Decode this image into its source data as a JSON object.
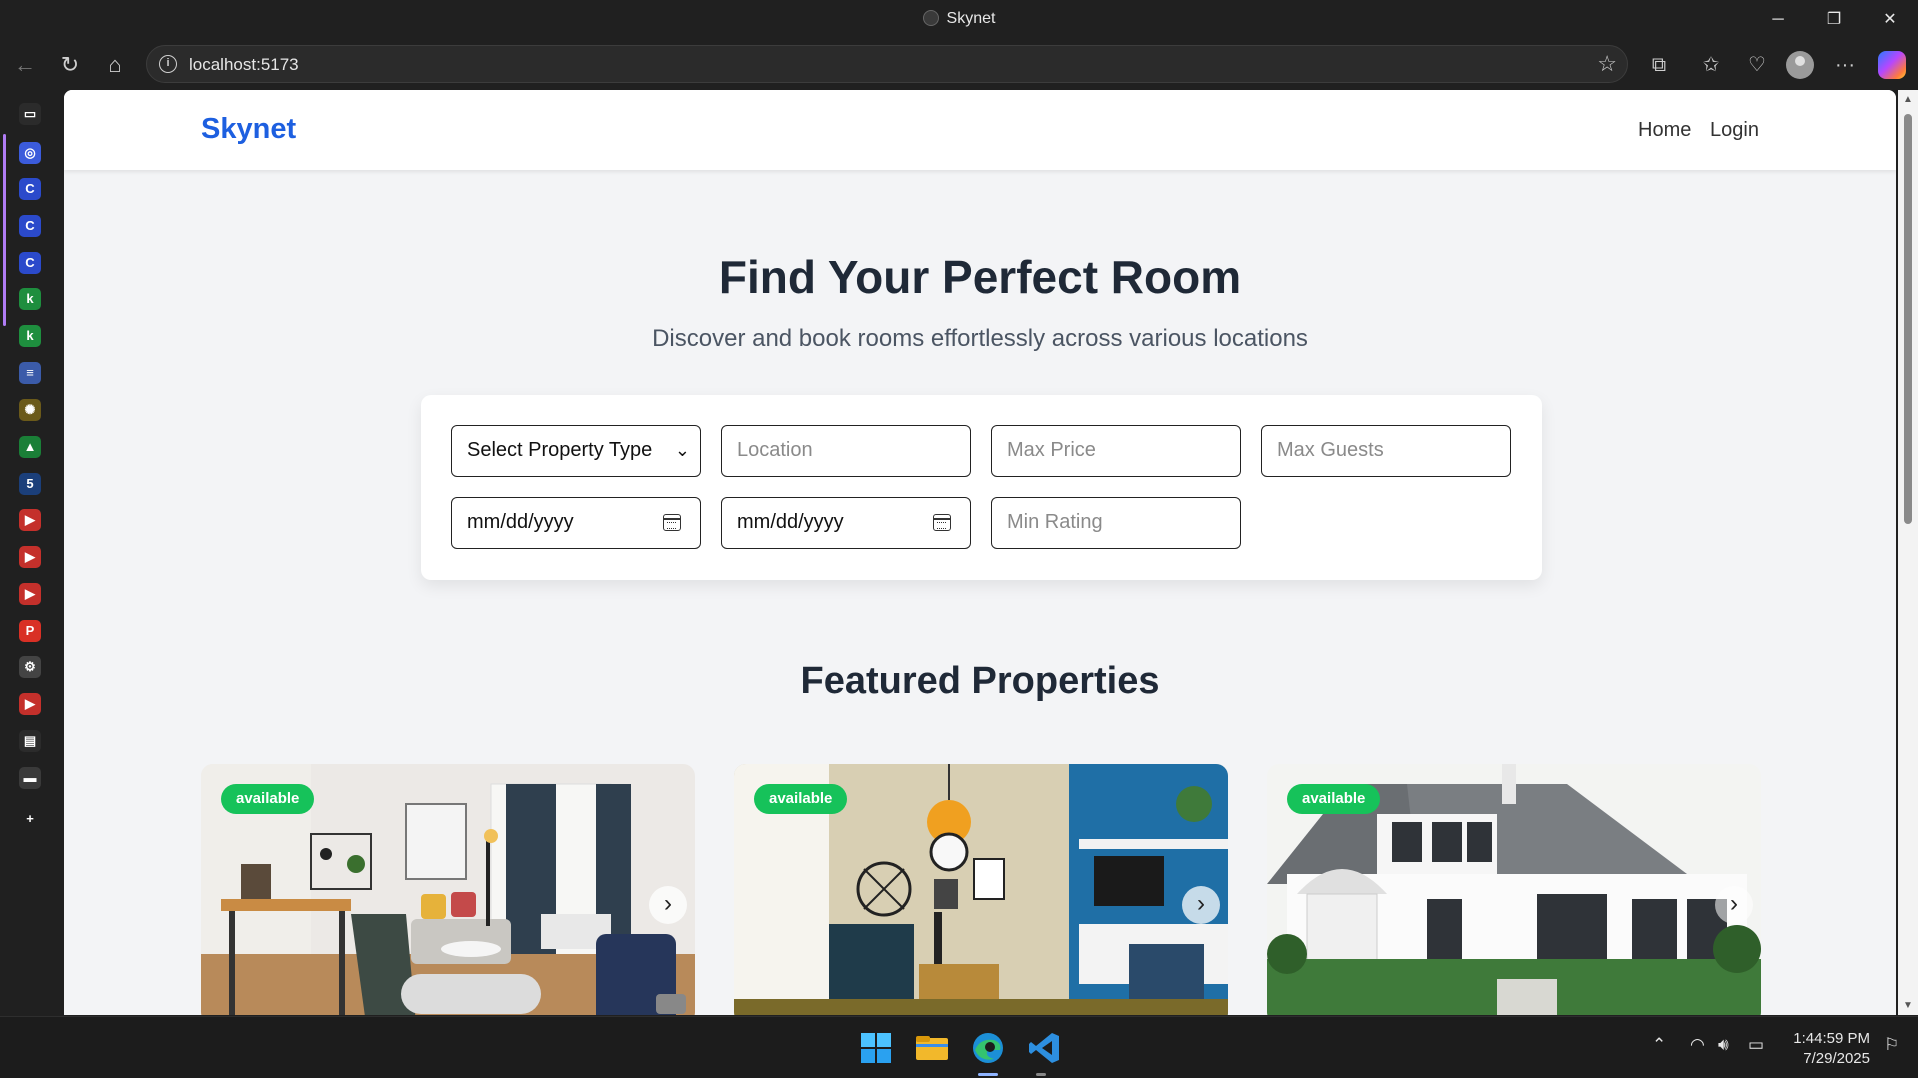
{
  "window": {
    "title": "Skynet",
    "minimize": "─",
    "maximize": "❐",
    "close": "✕"
  },
  "browser": {
    "url": "localhost:5173",
    "back_icon": "←",
    "refresh_icon": "↻",
    "home_icon": "⌂",
    "info_icon": "i",
    "star_icon": "☆",
    "extensions_icon": "⧉",
    "favorites_icon": "✩",
    "health_icon": "♡",
    "more_icon": "···"
  },
  "sidebar": {
    "items": [
      {
        "glyph": "▭",
        "color": "#2b2b2b"
      },
      {
        "glyph": "◎",
        "color": "#3b5bdb"
      },
      {
        "glyph": "C",
        "color": "#2b4acb"
      },
      {
        "glyph": "C",
        "color": "#2b4acb"
      },
      {
        "glyph": "C",
        "color": "#2b4acb"
      },
      {
        "glyph": "k",
        "color": "#1e8e3e"
      },
      {
        "glyph": "k",
        "color": "#1e8e3e"
      },
      {
        "glyph": "≡",
        "color": "#3b5ba9"
      },
      {
        "glyph": "✺",
        "color": "#6b5a1a"
      },
      {
        "glyph": "▲",
        "color": "#1a7f37"
      },
      {
        "glyph": "5",
        "color": "#1b3f7a"
      },
      {
        "glyph": "▶",
        "color": "#c4302b"
      },
      {
        "glyph": "▶",
        "color": "#c4302b"
      },
      {
        "glyph": "▶",
        "color": "#c4302b"
      },
      {
        "glyph": "P",
        "color": "#d93025"
      },
      {
        "glyph": "⚙",
        "color": "#444"
      },
      {
        "glyph": "▶",
        "color": "#c4302b"
      },
      {
        "glyph": "▤",
        "color": "#2b2b2b"
      },
      {
        "glyph": "▬",
        "color": "#3a3a3a"
      },
      {
        "glyph": "+",
        "color": "#202020"
      }
    ]
  },
  "nav": {
    "brand": "Skynet",
    "links": [
      "Home",
      "Login"
    ]
  },
  "hero": {
    "title": "Find Your Perfect Room",
    "subtitle": "Discover and book rooms effortlessly across various locations"
  },
  "search": {
    "property_type": "Select Property Type",
    "location_placeholder": "Location",
    "max_price_placeholder": "Max Price",
    "max_guests_placeholder": "Max Guests",
    "check_in": "mm/dd/yyyy",
    "check_out": "mm/dd/yyyy",
    "min_rating_placeholder": "Min Rating"
  },
  "featured": {
    "title": "Featured Properties",
    "cards": [
      {
        "status": "available",
        "image": "living-room-photo"
      },
      {
        "status": "available",
        "image": "lounge-photo"
      },
      {
        "status": "available",
        "image": "house-exterior-photo"
      }
    ]
  },
  "taskbar": {
    "time": "1:44:59 PM",
    "date": "7/29/2025"
  },
  "colors": {
    "brand": "#1d5fe0",
    "badge": "#16c25a",
    "page_bg": "#f3f4f6"
  }
}
